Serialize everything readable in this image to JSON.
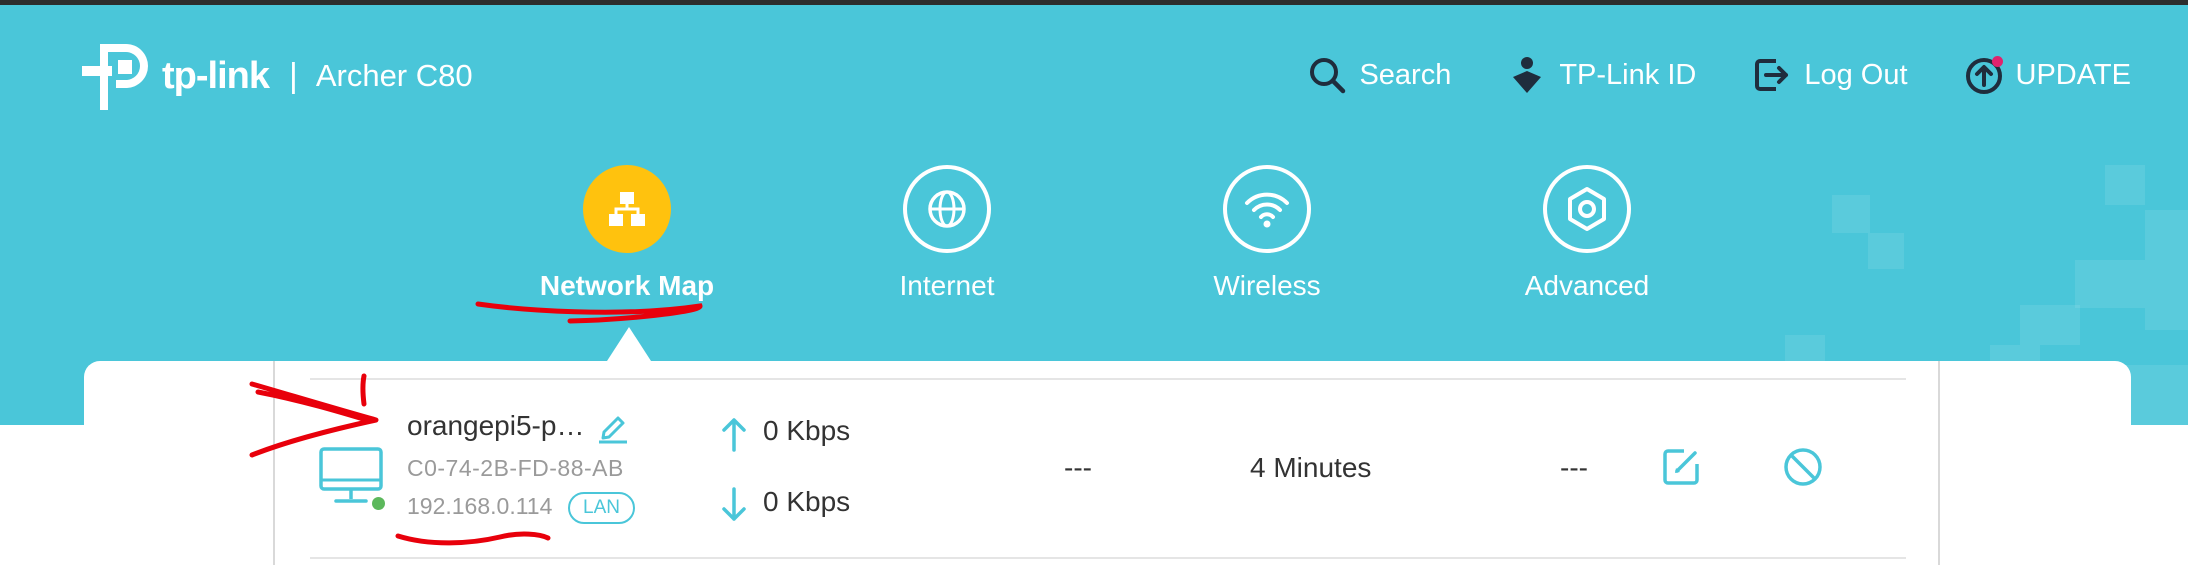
{
  "brand": {
    "logo_text": "tp-link",
    "separator": "|",
    "model": "Archer C80"
  },
  "top_actions": [
    {
      "label": "Search",
      "icon": "search-icon"
    },
    {
      "label": "TP-Link ID",
      "icon": "user-id-icon"
    },
    {
      "label": "Log Out",
      "icon": "logout-icon"
    },
    {
      "label": "UPDATE",
      "icon": "update-icon"
    }
  ],
  "nav": {
    "active": "Network Map",
    "items": [
      {
        "label": "Network Map",
        "icon": "network-map-icon"
      },
      {
        "label": "Internet",
        "icon": "globe-icon"
      },
      {
        "label": "Wireless",
        "icon": "wifi-icon"
      },
      {
        "label": "Advanced",
        "icon": "gear-icon"
      }
    ]
  },
  "client": {
    "name": "orangepi5-p…",
    "mac": "C0-74-2B-FD-88-AB",
    "ip": "192.168.0.114",
    "connection": "LAN",
    "upload": "0 Kbps",
    "download": "0 Kbps",
    "col_a": "---",
    "duration": "4 Minutes",
    "col_b": "---",
    "status": "online"
  },
  "colors": {
    "header": "#4ac6d9",
    "accent": "#4ac6d9",
    "active_nav": "#ffc20e",
    "online": "#5cb85c",
    "update_badge": "#e0236e",
    "annotation": "#e8000b"
  }
}
